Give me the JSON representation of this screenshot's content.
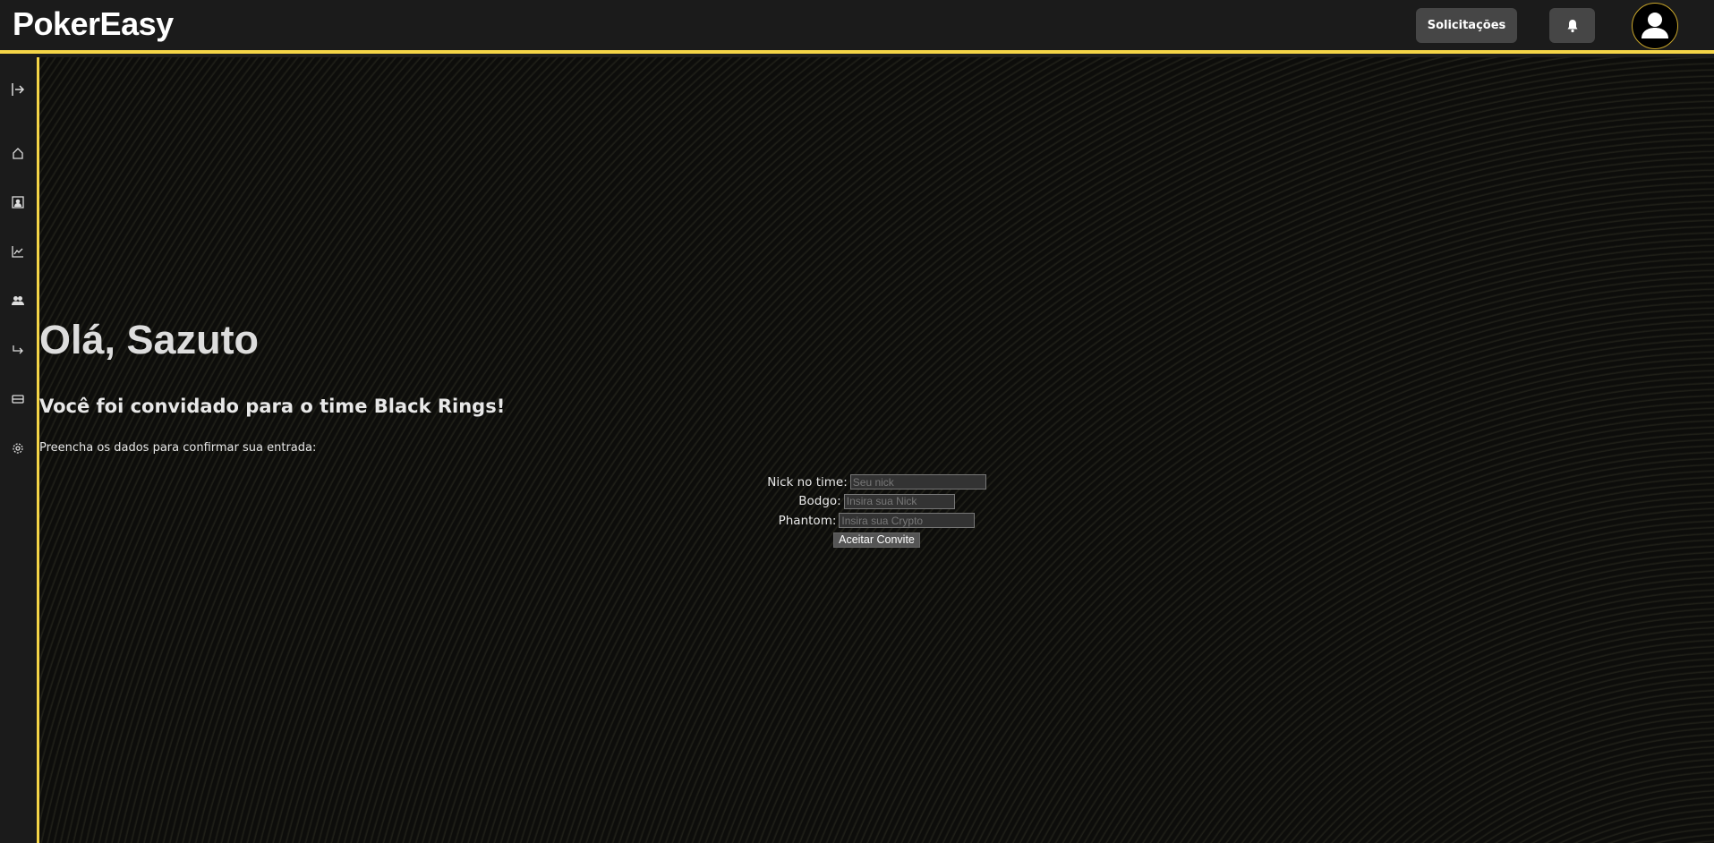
{
  "header": {
    "logo": "PokerEasy",
    "requests_label": "Solicitações"
  },
  "sidebar": {
    "items": [
      "expand",
      "home",
      "profile",
      "stats",
      "team",
      "redirect",
      "tickets",
      "settings"
    ]
  },
  "main": {
    "greeting": "Olá, Sazuto",
    "invite": "Você foi convidado para o time Black Rings!",
    "instructions": "Preencha os dados para confirmar sua entrada:",
    "fields": [
      {
        "label": "Nick no time:",
        "placeholder": "Seu nick",
        "value": ""
      },
      {
        "label": "Bodgo:",
        "placeholder": "Insira sua Nick",
        "value": ""
      },
      {
        "label": "Phantom:",
        "placeholder": "Insira sua Crypto",
        "value": ""
      }
    ],
    "accept_label": "Aceitar Convite"
  },
  "colors": {
    "accent": "#f5d547",
    "header_bg": "#1b1b1b",
    "button_bg": "#464646"
  }
}
